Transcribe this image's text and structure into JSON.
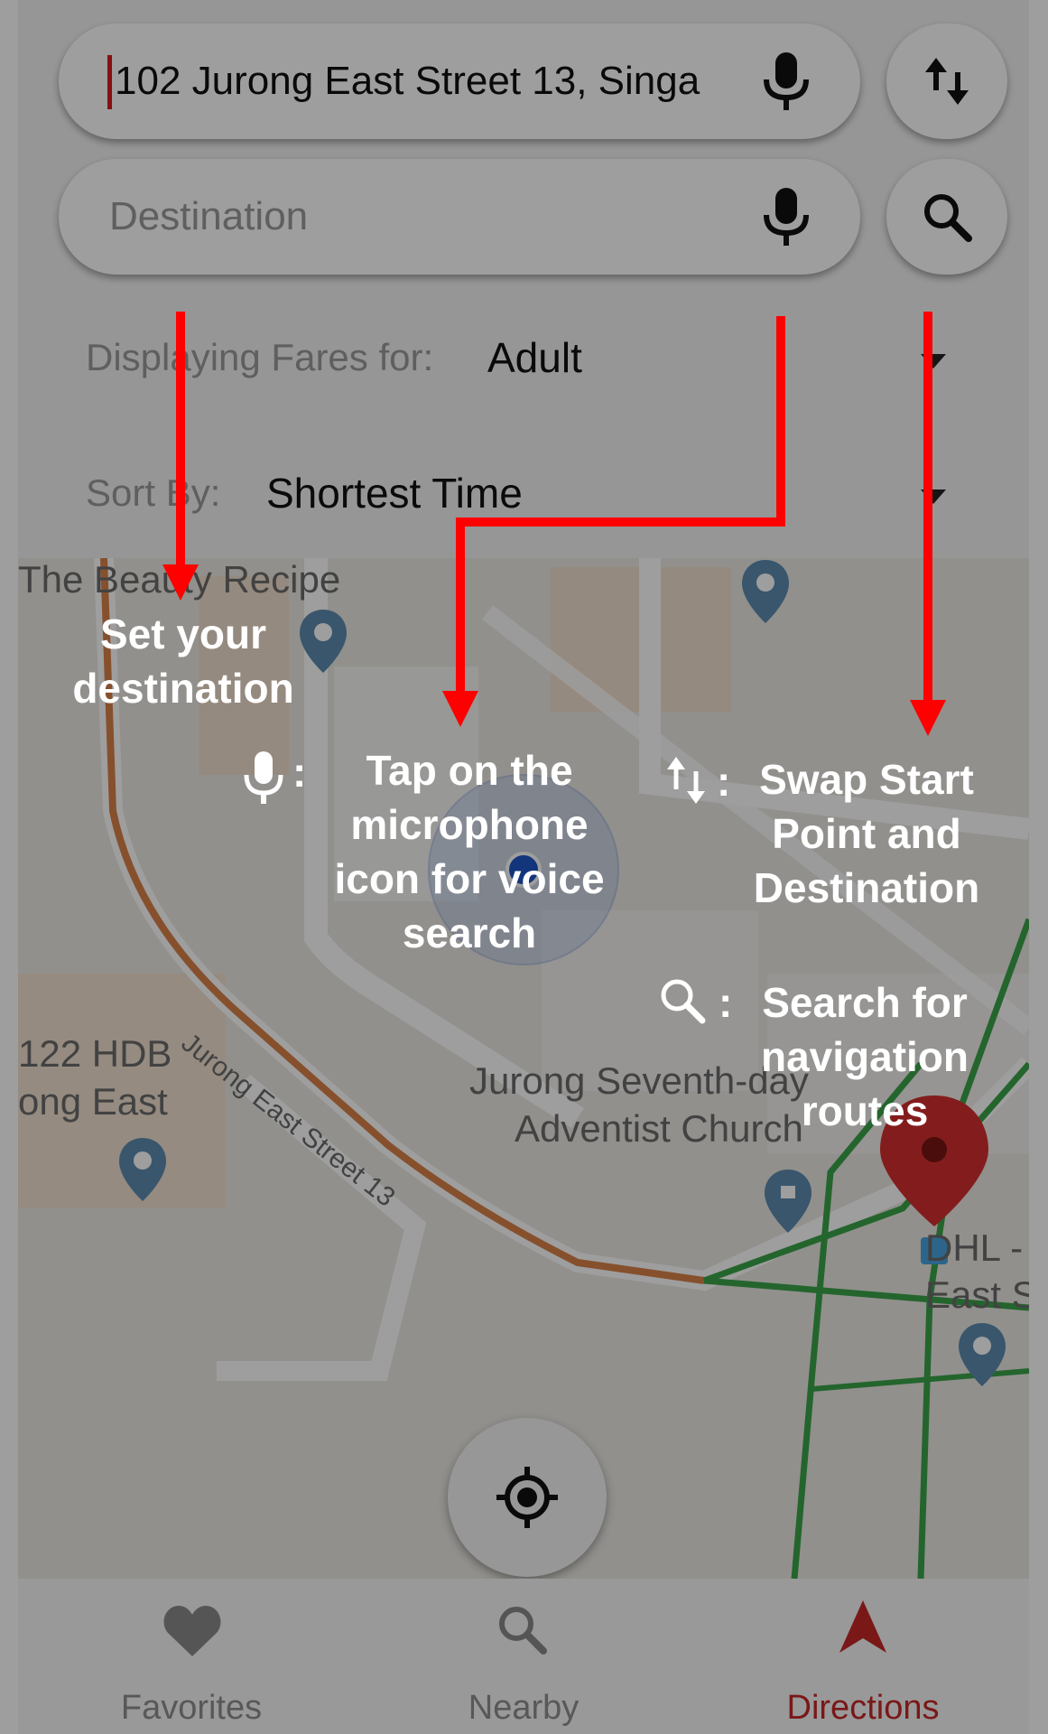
{
  "start": {
    "value": "102 Jurong East Street 13, Singa"
  },
  "destination": {
    "placeholder": "Destination"
  },
  "fares": {
    "label": "Displaying Fares for:",
    "value": "Adult"
  },
  "sort": {
    "label": "Sort By:",
    "value": "Shortest Time"
  },
  "map": {
    "places": [
      {
        "label": "The Beauty Recipe"
      },
      {
        "label": "122 HDB"
      },
      {
        "label": "ong East"
      },
      {
        "label": "Jurong Seventh-day"
      },
      {
        "label": "Adventist Church"
      },
      {
        "label": "DHL -"
      },
      {
        "label": "East S"
      }
    ],
    "street": "Jurong East Street 13"
  },
  "nav": {
    "items": [
      {
        "label": "Favorites",
        "icon": "heart-icon"
      },
      {
        "label": "Nearby",
        "icon": "search-icon"
      },
      {
        "label": "Directions",
        "icon": "navigation-arrow-icon",
        "active": true
      }
    ]
  },
  "annotations": {
    "set_destination": [
      "Set your",
      "destination"
    ],
    "mic_tip": [
      "Tap on the",
      "microphone",
      "icon for voice",
      "search"
    ],
    "mic_colon": ":",
    "swap_tip": [
      "Swap Start",
      "Point and",
      "Destination"
    ],
    "swap_colon": ":",
    "search_tip": [
      "Search for",
      "navigation",
      "routes"
    ],
    "search_colon": ":"
  },
  "colors": {
    "accent": "#c62828",
    "arrow": "#ff0000",
    "route_orange": "#d9824a",
    "route_green": "#3aa34a"
  }
}
